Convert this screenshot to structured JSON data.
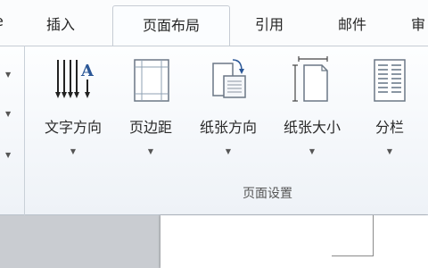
{
  "tabs": [
    {
      "label": "插入"
    },
    {
      "label": "页面布局"
    },
    {
      "label": "引用"
    },
    {
      "label": "邮件"
    },
    {
      "label": "审"
    }
  ],
  "ribbon": {
    "buttons": [
      {
        "label": "文字方向",
        "icon": "text-direction-icon"
      },
      {
        "label": "页边距",
        "icon": "margins-icon"
      },
      {
        "label": "纸张方向",
        "icon": "orientation-icon"
      },
      {
        "label": "纸张大小",
        "icon": "paper-size-icon"
      },
      {
        "label": "分栏",
        "icon": "columns-icon"
      }
    ],
    "group_label": "页面设置",
    "dropdown_glyph": "▼"
  },
  "colors": {
    "accent": "#2b5797",
    "tab_border": "#c6ccd4",
    "doc_bg": "#c9ccd1"
  }
}
